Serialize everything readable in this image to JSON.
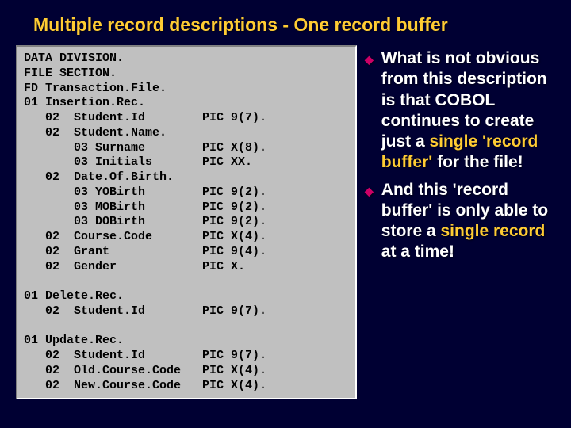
{
  "title": "Multiple record descriptions - One record buffer",
  "code": "DATA DIVISION.\nFILE SECTION.\nFD Transaction.File.\n01 Insertion.Rec.\n   02  Student.Id        PIC 9(7).\n   02  Student.Name.\n       03 Surname        PIC X(8).\n       03 Initials       PIC XX.\n   02  Date.Of.Birth.\n       03 YOBirth        PIC 9(2).\n       03 MOBirth        PIC 9(2).\n       03 DOBirth        PIC 9(2).\n   02  Course.Code       PIC X(4).\n   02  Grant             PIC 9(4).\n   02  Gender            PIC X.\n\n01 Delete.Rec.\n   02  Student.Id        PIC 9(7).\n\n01 Update.Rec.\n   02  Student.Id        PIC 9(7).\n   02  Old.Course.Code   PIC X(4).\n   02  New.Course.Code   PIC X(4).",
  "b1a": "What is not obvious from this description is that ",
  "b1b": "COBOL continues to create just a ",
  "b1c": "single 'record buffer'",
  "b1d": " for the file!",
  "b2a": "And this 'record buffer' is only able to store a ",
  "b2b": "single record",
  "b2c": " at a time!"
}
